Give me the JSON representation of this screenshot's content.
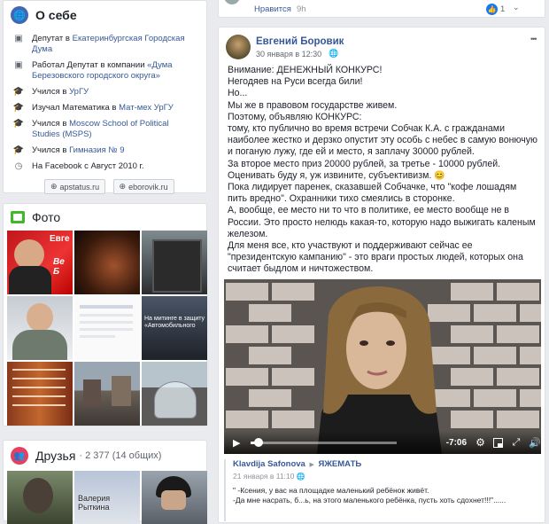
{
  "about": {
    "title": "О себе",
    "items": [
      {
        "icon": "briefcase-icon",
        "text": "Депутат в ",
        "link": "Екатеринбургская Городская Дума",
        "text2": ""
      },
      {
        "icon": "briefcase-icon",
        "text": "Работал Депутат в компании ",
        "link": "«Дума Березовского городского округа»",
        "text2": ""
      },
      {
        "icon": "graduation-cap-icon",
        "text": "Учился в ",
        "link": "УрГУ",
        "text2": ""
      },
      {
        "icon": "graduation-cap-icon",
        "text": "Изучал Математика в ",
        "link": "Мат-мех УрГУ",
        "text2": ""
      },
      {
        "icon": "graduation-cap-icon",
        "text": "Учился в ",
        "link": "Moscow School of Political Studies (MSPS)",
        "text2": ""
      },
      {
        "icon": "graduation-cap-icon",
        "text": "Учился в ",
        "link": "Гимназия № 9",
        "text2": ""
      },
      {
        "icon": "clock-icon",
        "text": "На Facebook с Август 2010 г.",
        "link": "",
        "text2": ""
      }
    ],
    "sites": [
      "apstatus.ru",
      "eborovik.ru"
    ]
  },
  "photos": {
    "title": "Фото",
    "tiles": [
      {
        "caption": "Евге",
        "caption2": "Be\nБ"
      },
      {
        "caption": "",
        "caption2": ""
      },
      {
        "caption": "",
        "caption2": ""
      },
      {
        "caption": "",
        "caption2": ""
      },
      {
        "caption": "",
        "caption2": ""
      },
      {
        "caption": "На митинге в защиту\n«Автомобильного",
        "caption2": ""
      },
      {
        "caption": "",
        "caption2": ""
      },
      {
        "caption": "",
        "caption2": ""
      },
      {
        "caption": "",
        "caption2": ""
      }
    ]
  },
  "friends": {
    "title": "Друзья",
    "count": "· 2 377 (14 общих)",
    "tiles": [
      {
        "name": ""
      },
      {
        "name": "Валерия\nРыткина"
      },
      {
        "name": ""
      }
    ]
  },
  "prev_post": {
    "like_label": "Нравится",
    "time": "9h",
    "reaction_count": "1"
  },
  "post": {
    "author": "Евгений Боровик",
    "date": "30 января в 12:30",
    "more": "•••",
    "lines": [
      "Внимание: ДЕНЕЖНЫЙ КОНКУРС!",
      "Негодяев на Руси всегда били!",
      "Но...",
      "Мы же в правовом государстве живем.",
      "Поэтому, объявляю КОНКУРС:",
      "тому, кто публично во время встречи Собчак К.А. с гражданами наиболее жестко и дерзко опустит эту особь с небес в самую вонючую и поганую лужу, где ей и место, я заплачу 30000 рублей.",
      "За второе место приз 20000 рублей, за третье - 10000 рублей.",
      "Оценивать буду я, уж извините, субъективизм.",
      "Пока лидирует паренек, сказавшей Собчачке, что \"кофе лошадям пить вредно\". Охранники тихо смеялись в сторонке.",
      "А, вообще, ее место ни то что в политике, ее место вообще не в России. Это просто нелюдь какая-то, которую надо выжигать каленым железом.",
      "Для меня все, кто участвуют и поддерживают сейчас ее \"президентскую кампанию\" - это враги простых людей, которых она считает быдлом и ничтожеством."
    ],
    "emoji": "😊",
    "video": {
      "time_left": "-7:06",
      "progress": 0.05
    }
  },
  "comment": {
    "author": "Klavdija Safonova",
    "arrow": "▶",
    "target": "ЯЖЕМАТЬ",
    "date": "21 января в 11:10",
    "lines": [
      "\" -Ксения, у вас на площадке маленький ребёнок живёт.",
      "-Да мне насрать, б...ь, на этого маленького ребёнка, пусть хоть сдохнет!!!\"......"
    ]
  }
}
